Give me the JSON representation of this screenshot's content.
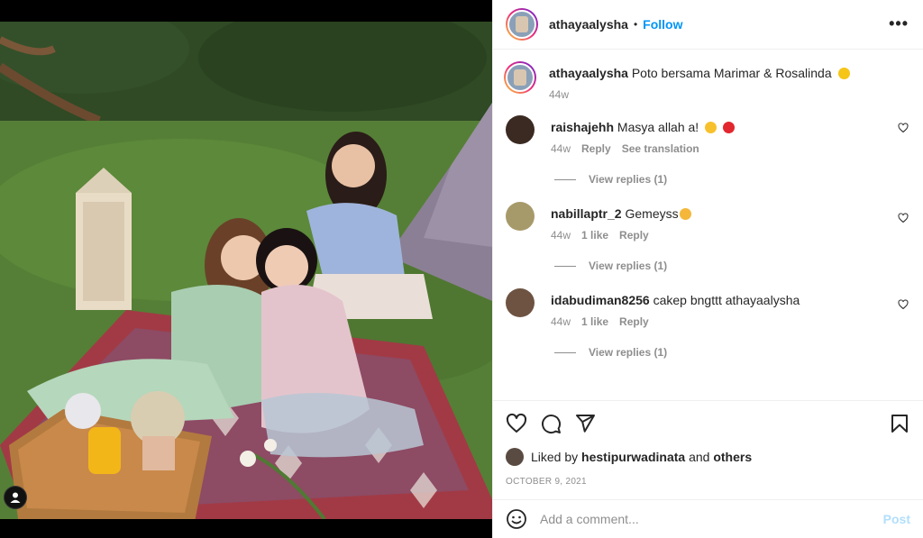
{
  "post": {
    "author": "athayaalysha",
    "follow_label": "Follow",
    "separator": "•",
    "more_label": "•••"
  },
  "caption": {
    "author": "athayaalysha",
    "text": "Poto bersama Marimar & Rosalinda",
    "emoji": "sunflower",
    "time": "44w"
  },
  "comments": [
    {
      "user": "raishajehh",
      "text": "Masya allah a!",
      "emojis": [
        "heart-eyes",
        "red-heart"
      ],
      "time": "44w",
      "likes": "",
      "reply": "Reply",
      "translate": "See translation",
      "view_replies": "View replies (1)"
    },
    {
      "user": "nabillaptr_2",
      "text": "Gemeyss",
      "emojis": [
        "smiling-face"
      ],
      "time": "44w",
      "likes": "1 like",
      "reply": "Reply",
      "translate": "",
      "view_replies": "View replies (1)"
    },
    {
      "user": "idabudiman8256",
      "text": "cakep bngttt athayaalysha",
      "emojis": [],
      "time": "44w",
      "likes": "1 like",
      "reply": "Reply",
      "translate": "",
      "view_replies": "View replies (1)"
    }
  ],
  "likes": {
    "prefix": "Liked by",
    "user": "hestipurwadinata",
    "and": "and",
    "others": "others"
  },
  "date": "OCTOBER 9, 2021",
  "comment_box": {
    "placeholder": "Add a comment...",
    "post_label": "Post"
  },
  "colors": {
    "link_blue": "#0095f6",
    "post_disabled": "#b2dffc",
    "muted": "#8e8e8e",
    "heart_red": "#ed4956"
  }
}
